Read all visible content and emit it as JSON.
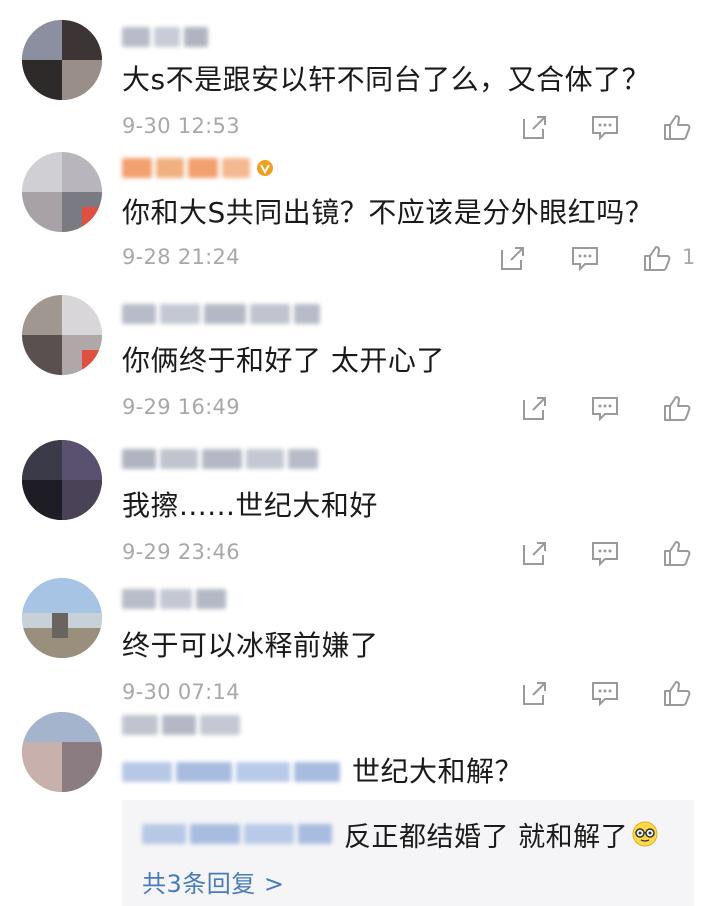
{
  "comments": [
    {
      "text": "大s不是跟安以轩不同台了么，又合体了？",
      "time": "9-30 12:53",
      "likes": ""
    },
    {
      "text": "你和大S共同出镜？不应该是分外眼红吗？",
      "time": "9-28 21:24",
      "likes": "1"
    },
    {
      "text": "你俩终于和好了 太开心了",
      "time": "9-29 16:49",
      "likes": ""
    },
    {
      "text": "我擦......世纪大和好",
      "time": "9-29 23:46",
      "likes": ""
    },
    {
      "text": "终于可以冰释前嫌了",
      "time": "9-30 07:14",
      "likes": ""
    },
    {
      "text": "世纪大和解？",
      "time": "",
      "likes": ""
    }
  ],
  "reply": {
    "text": "反正都结婚了 就和解了",
    "more_label": "共3条回复 >"
  },
  "icons": {
    "share": "share-icon",
    "comment": "comment-icon",
    "like": "like-icon",
    "emoji": "glasses-face-emoji"
  },
  "colors": {
    "meta_gray": "#a8a8a8",
    "link_blue": "#4a7bb7",
    "reply_bg": "#f5f5f7",
    "vip_orange": "#f0a020"
  }
}
